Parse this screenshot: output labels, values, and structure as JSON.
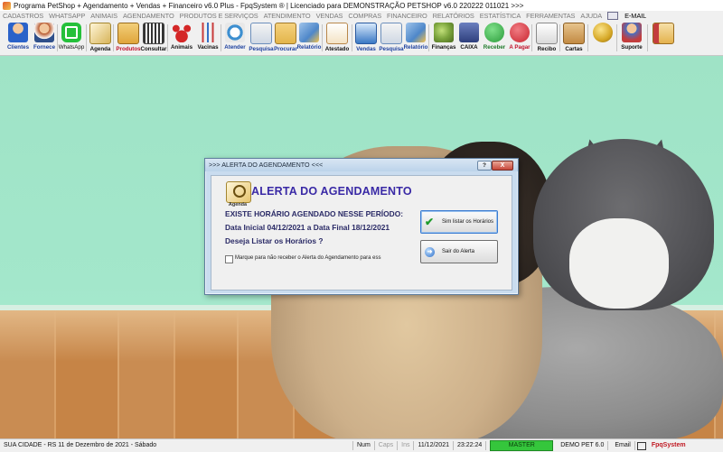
{
  "window": {
    "title": "Programa PetShop + Agendamento + Vendas + Financeiro v6.0 Plus - FpqSystem ® | Licenciado para  DEMONSTRAÇÃO PETSHOP v6.0 220222 011021 >>>"
  },
  "menu": {
    "items": [
      "CADASTROS",
      "WHATSAPP",
      "ANIMAIS",
      "AGENDAMENTO",
      "PRODUTOS E SERVIÇOS",
      "ATENDIMENTO",
      "VENDAS",
      "COMPRAS",
      "FINANCEIRO",
      "RELATÓRIOS",
      "ESTATÍSTICA",
      "FERRAMENTAS",
      "AJUDA"
    ],
    "email_label": "E-MAIL"
  },
  "toolbar": {
    "buttons": [
      {
        "label": "Clientes",
        "icon": "clients-icon",
        "color": "#2a62c9"
      },
      {
        "label": "Fornece",
        "icon": "supplier-icon",
        "color": "#b85a2f"
      },
      {
        "label": "WhatsApp",
        "icon": "whatsapp-icon",
        "color": "#25c03a"
      },
      {
        "label": "Agenda",
        "icon": "agenda-icon",
        "color": "#d7b45a"
      },
      {
        "label": "Produtos",
        "icon": "products-icon",
        "color": "#e0a53b"
      },
      {
        "label": "Consultar",
        "icon": "consult-icon",
        "color": "#6f6f6f"
      },
      {
        "label": "Animais",
        "icon": "paw-icon",
        "color": "#d42727"
      },
      {
        "label": "Vacinas",
        "icon": "vaccine-icon",
        "color": "#c93b3b"
      },
      {
        "label": "Atender",
        "icon": "attend-icon",
        "color": "#3d8fd0"
      },
      {
        "label": "Pesquisa",
        "icon": "search-icon",
        "color": "#6c8fbc"
      },
      {
        "label": "Procurar",
        "icon": "folder-search-icon",
        "color": "#e3b54b"
      },
      {
        "label": "Relatório",
        "icon": "report-icon",
        "color": "#4e87c9"
      },
      {
        "label": "Atestado",
        "icon": "certificate-icon",
        "color": "#d2a15a"
      },
      {
        "label": "Vendas",
        "icon": "sales-icon",
        "color": "#3a78c4"
      },
      {
        "label": "Pesquisa",
        "icon": "search-icon",
        "color": "#6c8fbc"
      },
      {
        "label": "Relatório",
        "icon": "report-icon",
        "color": "#4e87c9"
      },
      {
        "label": "Finanças",
        "icon": "finance-icon",
        "color": "#7aa33c"
      },
      {
        "label": "CAIXA",
        "icon": "cashier-icon",
        "color": "#2e3f7c"
      },
      {
        "label": "Receber",
        "icon": "receive-icon",
        "color": "#2a9b3a"
      },
      {
        "label": "A Pagar",
        "icon": "pay-icon",
        "color": "#c9252f"
      },
      {
        "label": "Recibo",
        "icon": "receipt-icon",
        "color": "#9d9d9d"
      },
      {
        "label": "Cartas",
        "icon": "letters-icon",
        "color": "#c28a43"
      },
      {
        "label": "",
        "icon": "coins-icon",
        "color": "#d5a726"
      },
      {
        "label": "Suporte",
        "icon": "support-icon",
        "color": "#4a6fc0"
      },
      {
        "label": "",
        "icon": "exit-icon",
        "color": "#c33d3d"
      }
    ]
  },
  "dialog": {
    "title": ">>> ALERTA DO AGENDAMENTO <<<",
    "help_btn": "?",
    "close_btn": "X",
    "icon_label": "Agenda",
    "heading": "ALERTA DO AGENDAMENTO",
    "line1": "EXISTE HORÁRIO AGENDADO NESSE PERÍODO:",
    "line2": "Data Inicial 04/12/2021 a Data Final 18/12/2021",
    "line3": "Deseja Listar os Horários ?",
    "checkbox_label": "Marque para não receber o Alerta do Agendamento para ess",
    "button_list": "Sim listar os Horários",
    "button_exit": "Sair do Alerta"
  },
  "status": {
    "city_date": "SUA CIDADE - RS 11 de Dezembro de 2021 - Sábado",
    "num": "Num",
    "caps": "Caps",
    "ins": "Ins",
    "date": "11/12/2021",
    "time": "23:22:24",
    "master": "MASTER",
    "version": "DEMO PET 6.0",
    "email": "Email",
    "brand": "FpqSystem",
    "master_color": "#35c63c",
    "brand_color": "#c01822"
  }
}
